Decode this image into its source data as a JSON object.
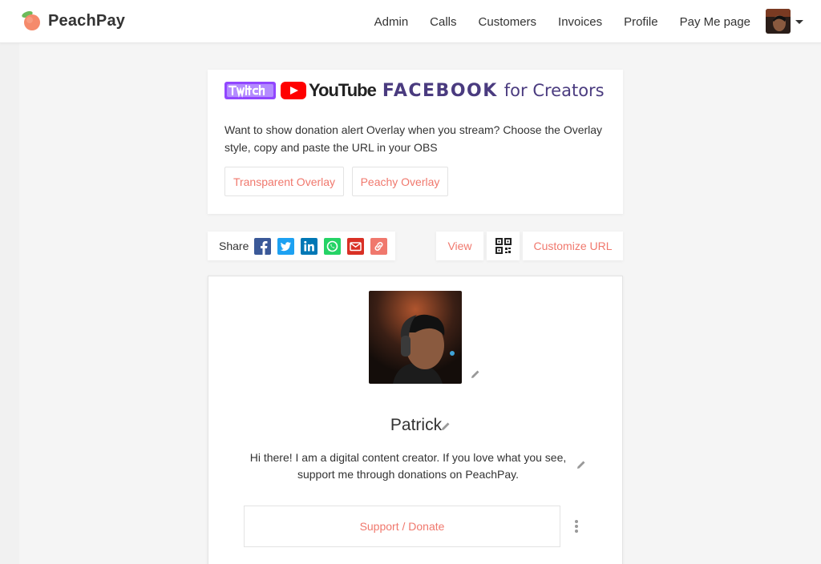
{
  "navbar": {
    "brand": "PeachPay",
    "links": [
      "Admin",
      "Calls",
      "Customers",
      "Invoices",
      "Profile",
      "Pay Me page"
    ]
  },
  "overlay": {
    "logos": {
      "twitch": "twitch",
      "youtube": "YouTube",
      "facebook": "FACEBOOK",
      "facebook_suffix": "for Creators"
    },
    "description": "Want to show donation alert Overlay when you stream? Choose the Overlay style, copy and paste the URL in your OBS",
    "buttons": {
      "transparent": "Transparent Overlay",
      "peachy": "Peachy Overlay"
    }
  },
  "share": {
    "label": "Share",
    "icons": [
      "facebook-icon",
      "twitter-icon",
      "linkedin-icon",
      "whatsapp-icon",
      "email-icon",
      "link-icon"
    ]
  },
  "actions": {
    "view": "View",
    "customize": "Customize URL"
  },
  "profile": {
    "name": "Patrick",
    "bio_line1": "Hi there! I am a digital content creator. If you love what you see,",
    "bio_line2": "support me through donations on PeachPay.",
    "support_button": "Support / Donate"
  },
  "colors": {
    "accent": "#f0786d",
    "facebook": "#3b5998",
    "twitter": "#1da1f2",
    "linkedin": "#0077b5",
    "whatsapp": "#25d366",
    "email": "#d93025",
    "link": "#f0786d",
    "twitch": "#9146ff",
    "youtube": "#ff0000",
    "facebook_creators": "#4a3b7f"
  }
}
